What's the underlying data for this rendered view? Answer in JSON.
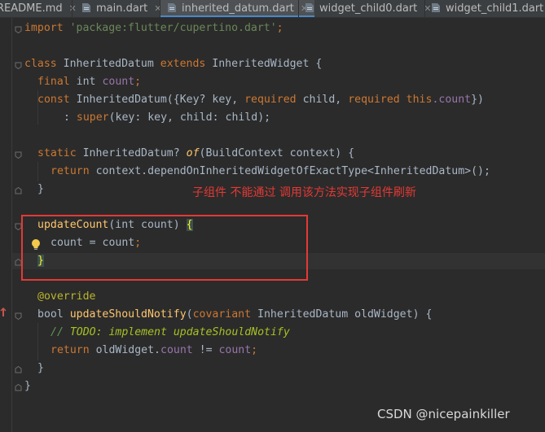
{
  "tabs": [
    {
      "label": "README.md",
      "icon": "markdown-file-icon",
      "active": false
    },
    {
      "label": "main.dart",
      "icon": "dart-file-icon",
      "active": false
    },
    {
      "label": "inherited_datum.dart",
      "icon": "dart-file-icon",
      "active": true
    },
    {
      "label": "widget_child0.dart",
      "icon": "dart-file-icon",
      "active": false
    },
    {
      "label": "widget_child1.dart",
      "icon": "dart-file-icon",
      "active": false
    }
  ],
  "close_glyph": "✕",
  "code": {
    "l1": {
      "kw": "import",
      "str": "'package:flutter/cupertino.dart'",
      "semi": ";"
    },
    "l3": {
      "kw1": "class",
      "name": "InheritedDatum",
      "kw2": "extends",
      "base": "InheritedWidget",
      "brace": "{"
    },
    "l4": {
      "kw": "final",
      "type": "int",
      "field": "count",
      "semi": ";"
    },
    "l5": {
      "kw": "const",
      "ctor": "InheritedDatum({Key? key,",
      "req1": "required",
      "p1": "child,",
      "req2": "required",
      "this": "this",
      "dotfield": ".count",
      "end": "})"
    },
    "l6": {
      "colon": ": ",
      "super": "super",
      "rest": "(key: key, child: child);"
    },
    "l8": {
      "kw": "static",
      "type": "InheritedDatum?",
      "fn": "of",
      "rest": "(BuildContext context) {"
    },
    "l9": {
      "kw": "return",
      "rest": "context.dependOnInheritedWidgetOfExactType<InheritedDatum>();"
    },
    "l10": {
      "brace": "}"
    },
    "l12": {
      "fn": "updateCount",
      "rest": "(int count) ",
      "brace": "{"
    },
    "l13": {
      "lhs": "count = count",
      "semi": ";"
    },
    "l14": {
      "brace": "}"
    },
    "l16": {
      "ann": "@override"
    },
    "l17": {
      "type": "bool",
      "fn": "updateShouldNotify",
      "open": "(",
      "kw": "covariant",
      "rest": "InheritedDatum oldWidget) {"
    },
    "l18": {
      "cmt": "// ",
      "todo": "TODO: implement updateShouldNotify"
    },
    "l19": {
      "kw": "return",
      "mid": "oldWidget.",
      "field1": "count",
      "op": " != ",
      "field2": "count",
      "semi": ";"
    },
    "l20": {
      "brace": "}"
    },
    "l21": {
      "brace": "}"
    }
  },
  "annotation": "子组件 不能通过 调用该方法实现子组件刷新",
  "watermark": "CSDN @nicepainkiller",
  "colors": {
    "editor_bg": "#2b2b2b",
    "keyword": "#cc7832",
    "string": "#6a8759",
    "field": "#9876aa",
    "function": "#ffc66d",
    "annotation": "#bbb529",
    "comment": "#629755",
    "highlight_box": "#e53935",
    "active_tab_underline": "#4a88c7"
  }
}
